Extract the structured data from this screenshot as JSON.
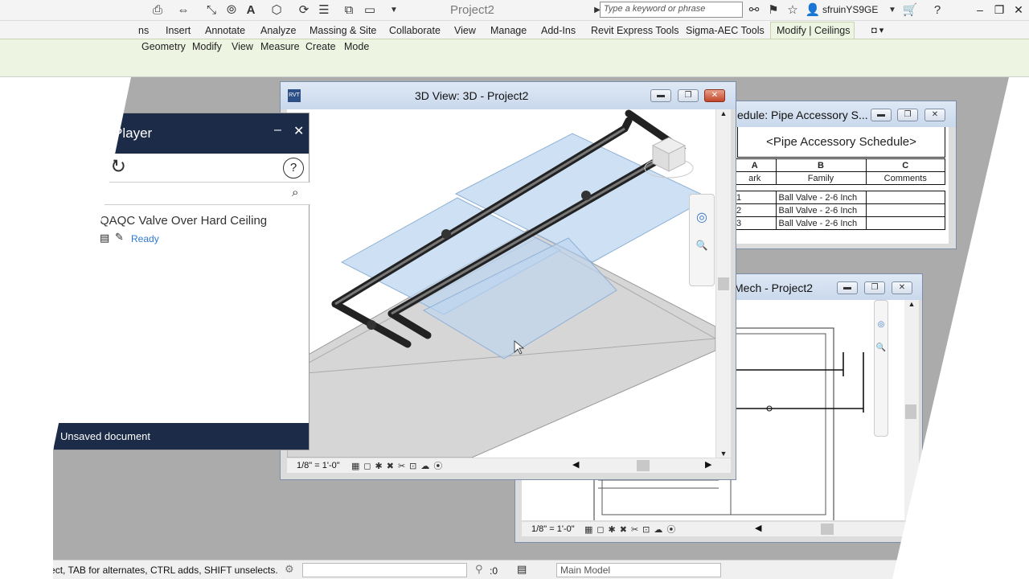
{
  "app": {
    "title": "Project2",
    "search_placeholder": "Type a keyword or phrase",
    "user": "sfruinYS9GE"
  },
  "ribbon": {
    "tabs": [
      "ns",
      "Insert",
      "Annotate",
      "Analyze",
      "Massing & Site",
      "Collaborate",
      "View",
      "Manage",
      "Add-Ins",
      "Revit Express Tools",
      "Sigma-AEC Tools",
      "Modify | Ceilings"
    ],
    "active_tab": "Modify | Ceilings",
    "panels": [
      "Geometry",
      "Modify",
      "View",
      "Measure",
      "Create",
      "Mode"
    ]
  },
  "view3d": {
    "title": "3D View: 3D - Project2",
    "scale": "1/8\" = 1'-0\""
  },
  "schedule": {
    "title": "edule: Pipe Accessory S...",
    "heading": "<Pipe Accessory Schedule>",
    "col_letters": [
      "A",
      "B",
      "C"
    ],
    "col_names": [
      "ark",
      "Family",
      "Comments"
    ],
    "rows": [
      {
        "mark": "1",
        "family": "Ball Valve - 2-6 Inch",
        "comments": ""
      },
      {
        "mark": "2",
        "family": "Ball Valve - 2-6 Inch",
        "comments": ""
      },
      {
        "mark": "3",
        "family": "Ball Valve - 2-6 Inch",
        "comments": ""
      }
    ]
  },
  "mech_view": {
    "title": "Mech - Project2",
    "scale": "1/8\" = 1'-0\""
  },
  "player": {
    "title": "Player",
    "item_title": "QAQC Valve Over Hard Ceiling",
    "item_status": "Ready",
    "footer": "Unsaved document"
  },
  "statusbar": {
    "hint": "Click to select, TAB for alternates, CTRL adds, SHIFT unselects.",
    "selection_count": ":0",
    "model": "Main Model"
  },
  "colors": {
    "player_navy": "#1c2b47",
    "ribbon_green": "#eef4e2",
    "ready_blue": "#2f7ad1",
    "ceiling_blue": "#bcd6f0"
  }
}
